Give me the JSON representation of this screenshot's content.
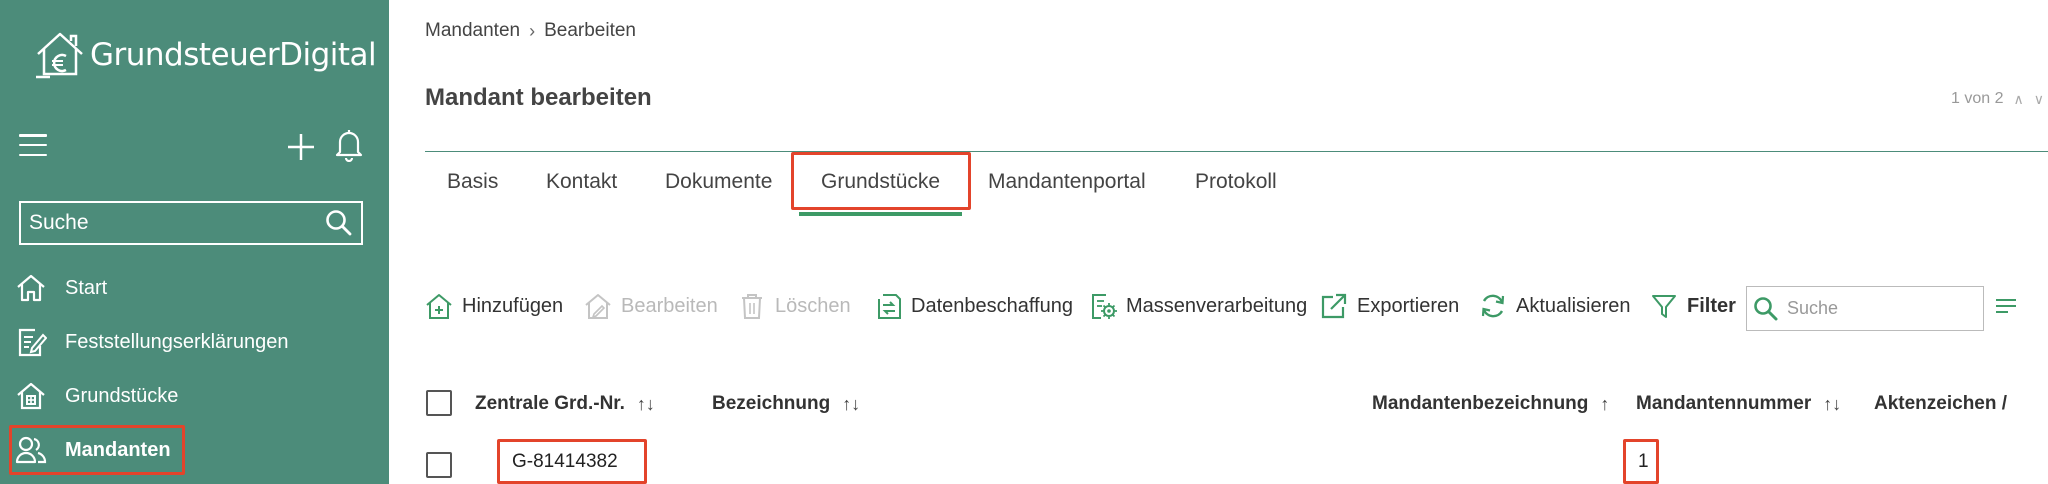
{
  "app": {
    "logo_text": "GrundsteuerDigital"
  },
  "sidebar": {
    "search_placeholder": "Suche",
    "items": [
      {
        "label": "Start",
        "icon": "home-icon"
      },
      {
        "label": "Feststellungserklärungen",
        "icon": "document-edit-icon"
      },
      {
        "label": "Grundstücke",
        "icon": "property-icon"
      },
      {
        "label": "Mandanten",
        "icon": "users-icon",
        "active": true
      }
    ]
  },
  "breadcrumb": {
    "root": "Mandanten",
    "current": "Bearbeiten"
  },
  "page": {
    "title": "Mandant bearbeiten",
    "pager": "1 von 2"
  },
  "tabs": [
    "Basis",
    "Kontakt",
    "Dokumente",
    "Grundstücke",
    "Mandantenportal",
    "Protokoll"
  ],
  "active_tab": "Grundstücke",
  "toolbar": {
    "add": "Hinzufügen",
    "edit": "Bearbeiten",
    "delete": "Löschen",
    "data": "Datenbeschaffung",
    "mass": "Massenverarbeitung",
    "export": "Exportieren",
    "refresh": "Aktualisieren",
    "filter": "Filter",
    "search_placeholder": "Suche"
  },
  "table": {
    "columns": [
      "Zentrale Grd.-Nr.",
      "Bezeichnung",
      "Mandantenbezeichnung",
      "Mandantennummer",
      "Aktenzeichen /"
    ],
    "rows": [
      {
        "zentrale_nr": "G-81414382",
        "bezeichnung": "",
        "mandantenbezeichnung": "",
        "mandantennummer": "1",
        "aktenzeichen": ""
      }
    ]
  },
  "colors": {
    "sidebar": "#4c8c7a",
    "accent_green": "#3d9a66",
    "highlight_red": "#e3442b"
  }
}
